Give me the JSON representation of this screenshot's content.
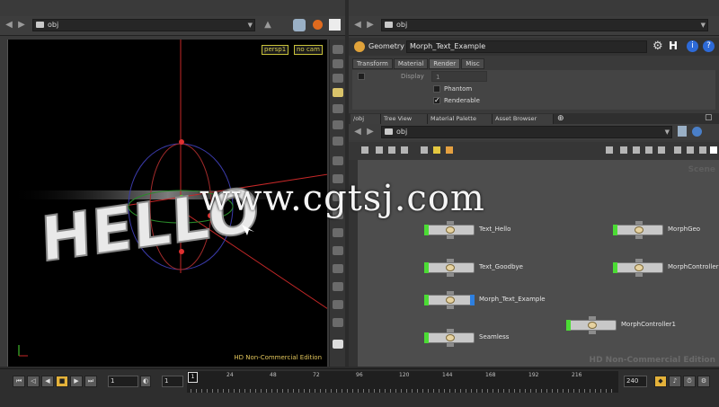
{
  "left_pane": {
    "path": "obj",
    "cam_menu": "persp1",
    "view_menu": "no cam",
    "edition": "HD Non-Commercial Edition",
    "scene_text": "HELLO"
  },
  "right_pane": {
    "path": "obj",
    "node_type": "Geometry",
    "node_name": "Morph_Text_Example",
    "tabs": [
      "Transform",
      "Material",
      "Render",
      "Misc"
    ],
    "active_tab": "Render",
    "display_label": "Display",
    "display_value": "1",
    "phantom_label": "Phantom",
    "renderable_label": "Renderable"
  },
  "network": {
    "pane_tabs": [
      "/obj",
      "Tree View",
      "Material Palette",
      "Asset Browser"
    ],
    "path": "obj",
    "ghost_text": "Scene",
    "watermark": "HD Non-Commercial Edition",
    "nodes": [
      {
        "label": "Text_Hello"
      },
      {
        "label": "Text_Goodbye"
      },
      {
        "label": "Morph_Text_Example"
      },
      {
        "label": "Seamless"
      },
      {
        "label": "MorphGeo"
      },
      {
        "label": "MorphController"
      },
      {
        "label": "MorphController1"
      }
    ]
  },
  "timeline": {
    "current_frame": "1",
    "start_frame": "1",
    "end_frame": "240",
    "ticks": [
      "24",
      "48",
      "72",
      "96",
      "120",
      "144",
      "168",
      "192",
      "216"
    ],
    "cursor_frame": "1"
  },
  "overlay": {
    "site": "www.cgtsj.com"
  },
  "colors": {
    "node_flag_green": "#4bdc34",
    "node_flag_blue": "#2d7fe0",
    "viewport_bg": "#000000",
    "network_bg": "#4d4d4d"
  }
}
